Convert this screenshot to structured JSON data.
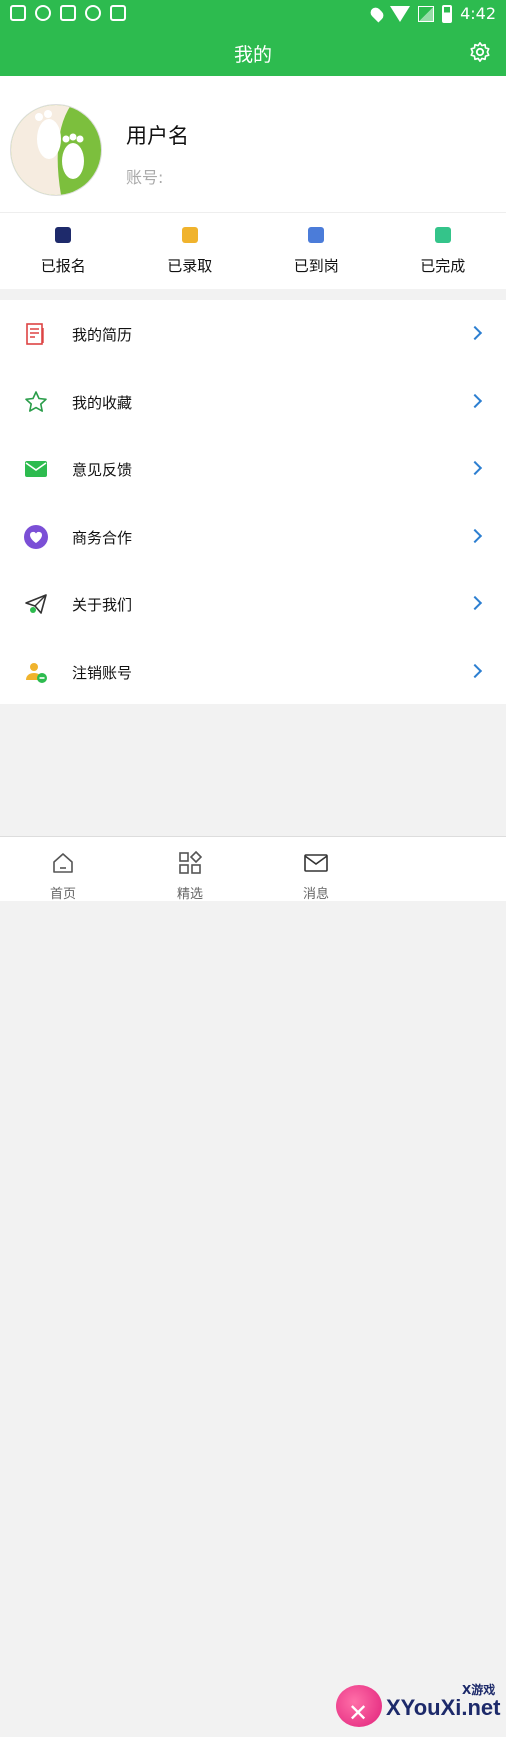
{
  "statusbar": {
    "time": "4:42"
  },
  "header": {
    "title": "我的"
  },
  "profile": {
    "username": "用户名",
    "account_label": "账号:"
  },
  "status_items": [
    {
      "label": "已报名",
      "color": "#1e2a6b"
    },
    {
      "label": "已录取",
      "color": "#f0b32d"
    },
    {
      "label": "已到岗",
      "color": "#4b7cd9"
    },
    {
      "label": "已完成",
      "color": "#34c48a"
    }
  ],
  "menu": [
    {
      "label": "我的简历",
      "icon": "resume-icon"
    },
    {
      "label": "我的收藏",
      "icon": "star-icon"
    },
    {
      "label": "意见反馈",
      "icon": "mail-icon"
    },
    {
      "label": "商务合作",
      "icon": "heart-icon"
    },
    {
      "label": "关于我们",
      "icon": "paper-plane-icon"
    },
    {
      "label": "注销账号",
      "icon": "user-remove-icon"
    }
  ],
  "bottom_nav": [
    {
      "label": "首页",
      "icon": "home-icon"
    },
    {
      "label": "精选",
      "icon": "grid-icon"
    },
    {
      "label": "消息",
      "icon": "message-icon"
    }
  ],
  "watermark": {
    "brand": "XYouXi.net",
    "tag": "X游戏"
  },
  "colors": {
    "primary": "#2dbb4f",
    "chevron": "#2d7fd1"
  }
}
